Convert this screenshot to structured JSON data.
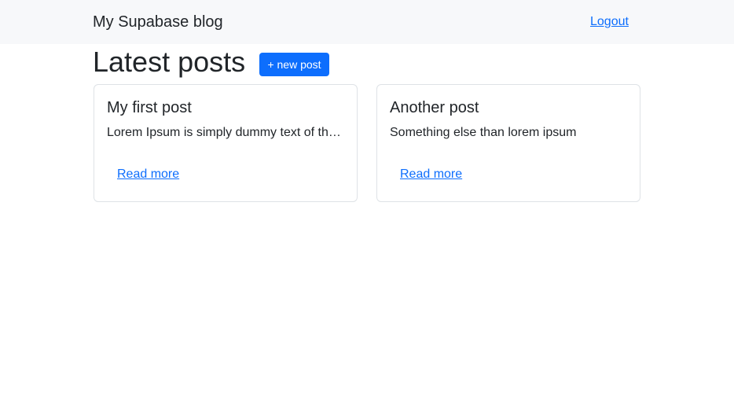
{
  "navbar": {
    "brand": "My Supabase blog",
    "logout_label": "Logout"
  },
  "main": {
    "title": "Latest posts",
    "new_post_label": "+ new post",
    "posts": [
      {
        "title": "My first post",
        "excerpt": "Lorem Ipsum is simply dummy text of the printing and typesetting industry.",
        "link_label": "Read more"
      },
      {
        "title": "Another post",
        "excerpt": "Something else than lorem ipsum",
        "link_label": "Read more"
      }
    ]
  },
  "colors": {
    "accent": "#0d6efd",
    "navbar_bg": "#f7f8fa",
    "card_border": "#dee2e6",
    "text": "#212529"
  }
}
